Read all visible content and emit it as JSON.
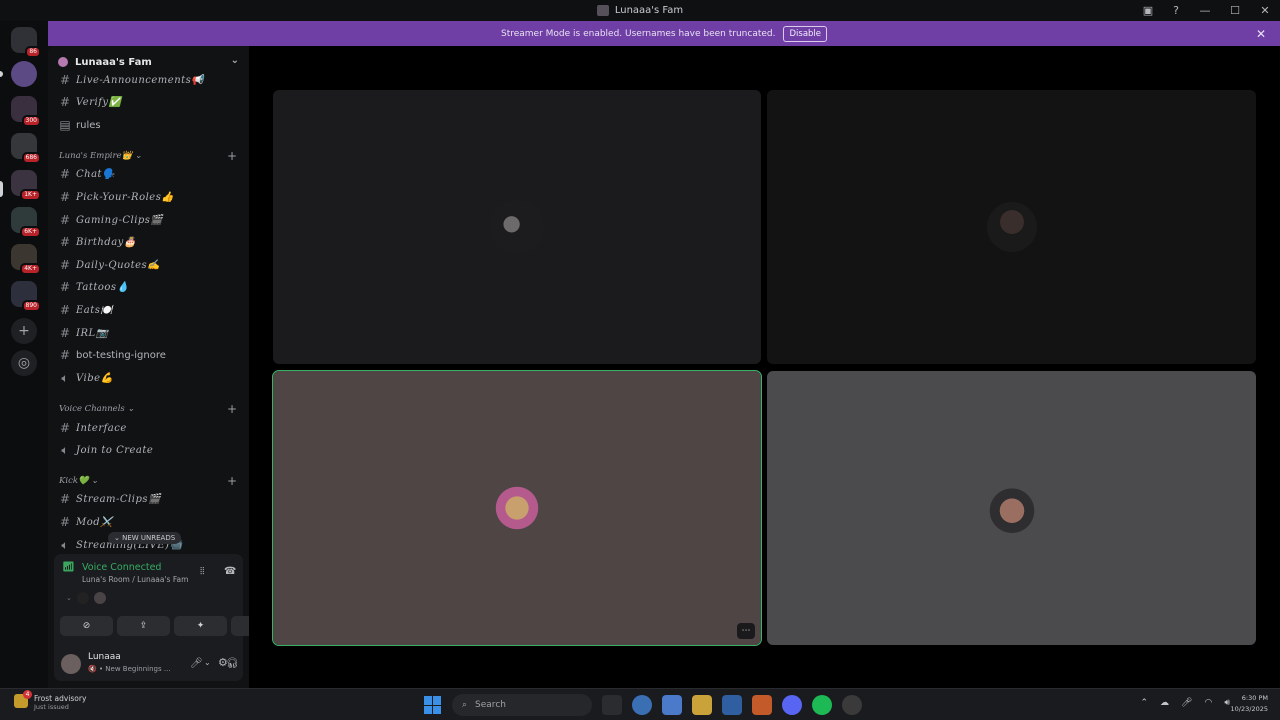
{
  "window": {
    "title": "Lunaaa's Fam"
  },
  "notice": {
    "text": "Streamer Mode is enabled. Usernames have been truncated.",
    "disable_label": "Disable"
  },
  "servers": {
    "badges": [
      "86",
      "300",
      "686",
      "1K+",
      "6K+",
      "4K+",
      "890"
    ]
  },
  "guild": {
    "name": "Lunaaa's Fam"
  },
  "channels": {
    "top": [
      {
        "name": "Live-Announcements📢",
        "icon": "hash"
      },
      {
        "name": "Verify✅",
        "icon": "hash"
      },
      {
        "name": "rules",
        "icon": "rules"
      }
    ],
    "cat1": {
      "name": "Luna's Empire👑 ⌄",
      "items": [
        {
          "name": "Chat🗣️",
          "icon": "hash"
        },
        {
          "name": "Pick-Your-Roles👍",
          "icon": "hash"
        },
        {
          "name": "Gaming-Clips🎬",
          "icon": "hash"
        },
        {
          "name": "Birthday🎂",
          "icon": "hash"
        },
        {
          "name": "Daily-Quotes✍️",
          "icon": "hash"
        },
        {
          "name": "Tattoos💧",
          "icon": "hash"
        },
        {
          "name": "Eats🍽️",
          "icon": "hash"
        },
        {
          "name": "IRL📷",
          "icon": "hash"
        },
        {
          "name": "bot-testing-ignore",
          "icon": "hash"
        },
        {
          "name": "Vibe💪",
          "icon": "speaker"
        }
      ]
    },
    "cat2": {
      "name": "Voice Channels ⌄",
      "items": [
        {
          "name": "Interface",
          "icon": "hash"
        },
        {
          "name": "Join to Create",
          "icon": "speaker"
        }
      ]
    },
    "cat3": {
      "name": "Kick💚 ⌄",
      "items": [
        {
          "name": "Stream-Clips🎬",
          "icon": "hash"
        },
        {
          "name": "Mod⚔️",
          "icon": "hash"
        },
        {
          "name": "Streaming(LIVE)📹",
          "icon": "speaker"
        }
      ]
    },
    "new_unreads": "⌄ NEW UNREADS"
  },
  "voice": {
    "status": "Voice Connected",
    "location": "Luna's Room / Lunaaa's Fam"
  },
  "user": {
    "name": "Lunaaa",
    "status": "🔇 • New Beginnings ..."
  },
  "taskbar": {
    "weather_title": "Frost advisory",
    "weather_sub": "Just issued",
    "weather_badge": "4",
    "search_placeholder": "Search",
    "time": "6:30 PM",
    "date": "10/23/2025"
  },
  "colors": {
    "accent_purple": "#6f3fa6",
    "voice_green": "#35ad64",
    "speaking_outline": "#3bb167",
    "badge_red": "#b8232a"
  }
}
